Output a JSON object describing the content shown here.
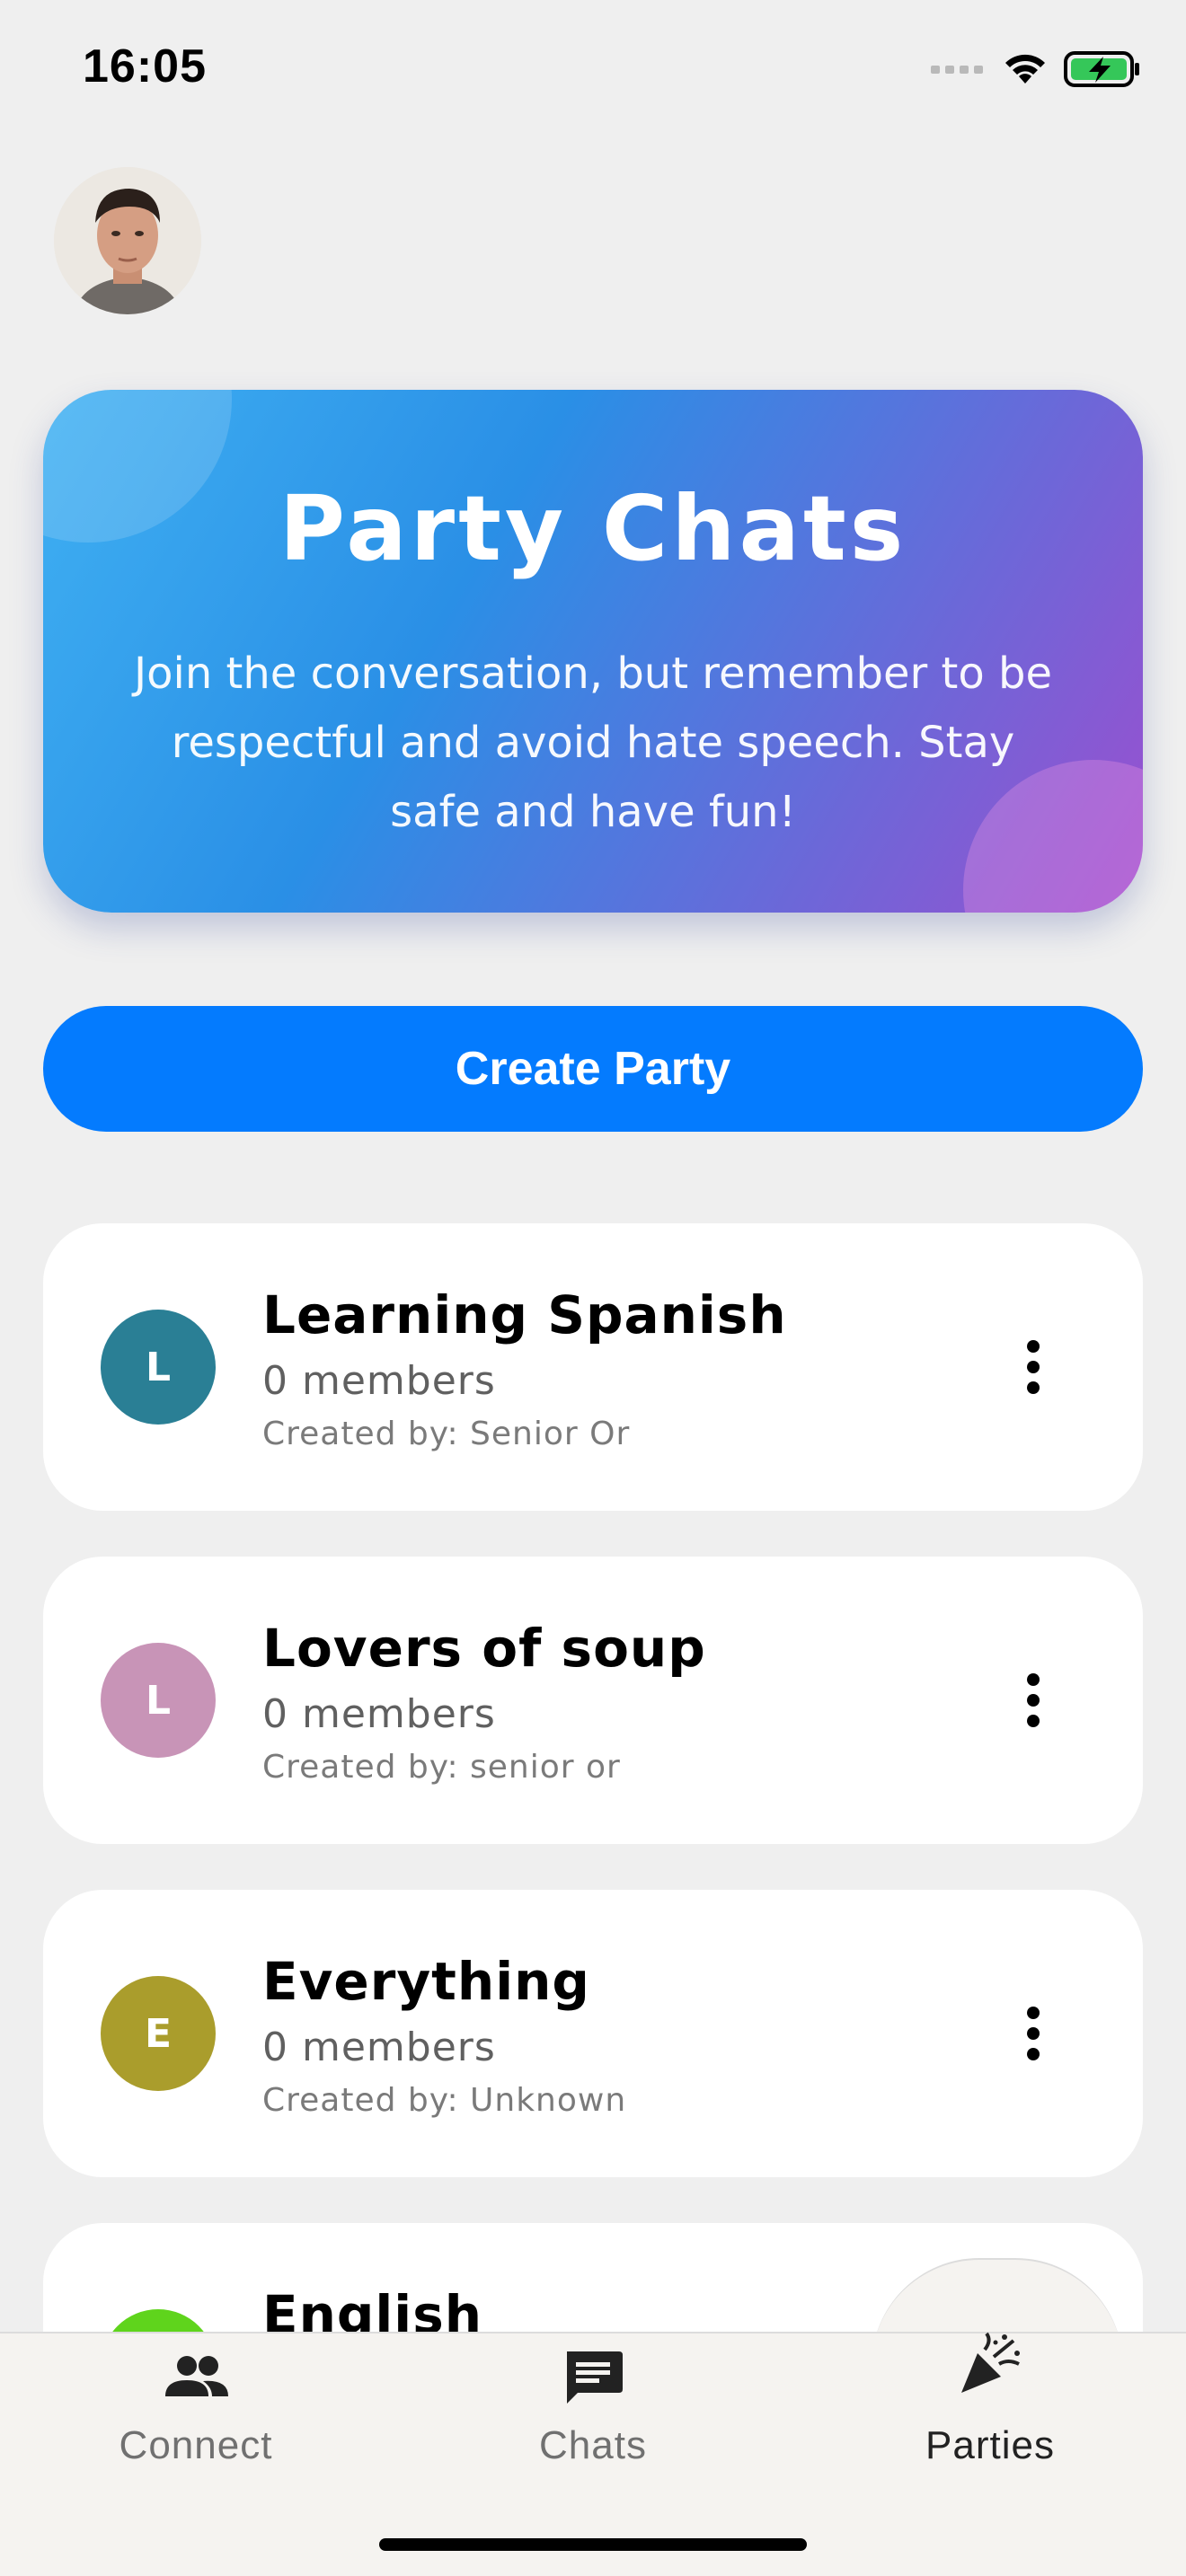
{
  "status": {
    "time": "16:05"
  },
  "profile": {
    "avatar_icon": "user-avatar-photo"
  },
  "hero": {
    "title": "Party Chats",
    "message": "Join the conversation, but remember to be respectful and avoid hate speech. Stay safe and have fun!"
  },
  "create_button": {
    "label": "Create Party"
  },
  "parties": [
    {
      "initial": "L",
      "name": "Learning Spanish",
      "members": "0 members",
      "creator": "Created by: Senior Or",
      "color": "#2a7f95"
    },
    {
      "initial": "L",
      "name": "Lovers of soup",
      "members": "0 members",
      "creator": "Created by: senior or",
      "color": "#c894b7"
    },
    {
      "initial": "E",
      "name": "Everything",
      "members": "0 members",
      "creator": "Created by: Unknown",
      "color": "#aa9d2c"
    },
    {
      "initial": "",
      "name": "English",
      "members": "",
      "creator": "",
      "color": "#5fd41c"
    }
  ],
  "nav": {
    "items": [
      {
        "label": "Connect",
        "icon": "people-icon"
      },
      {
        "label": "Chats",
        "icon": "chat-icon"
      },
      {
        "label": "Parties",
        "icon": "party-popper-icon"
      }
    ],
    "active_color": "#222222",
    "inactive_color": "#707070"
  }
}
